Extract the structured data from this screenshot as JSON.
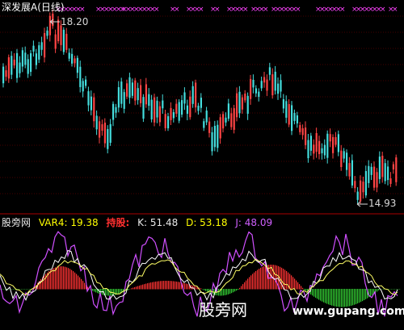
{
  "title": "深发展A(日线)",
  "price_panel": {
    "high_label": "18.20",
    "low_label": "14.93",
    "high_value": 18.2,
    "low_value": 14.93
  },
  "indicator_bar": {
    "name": "股旁网",
    "var4": "VAR4: 19.38",
    "hold": "持股:",
    "k": "K: 51.48",
    "d": "D: 53.18",
    "j": "J: 48.09"
  },
  "watermark": {
    "text": "股旁网",
    "url": "www.gupang.com"
  },
  "colors": {
    "up": "#ff4444",
    "down": "#44dddd",
    "marker": "#ff44ff",
    "k_line": "#ffffff",
    "d_line": "#ffff66",
    "j_line": "#d050ff",
    "hist_pos": "#ff3333",
    "hist_neg": "#33cc33",
    "grid": "#8b0000"
  }
}
